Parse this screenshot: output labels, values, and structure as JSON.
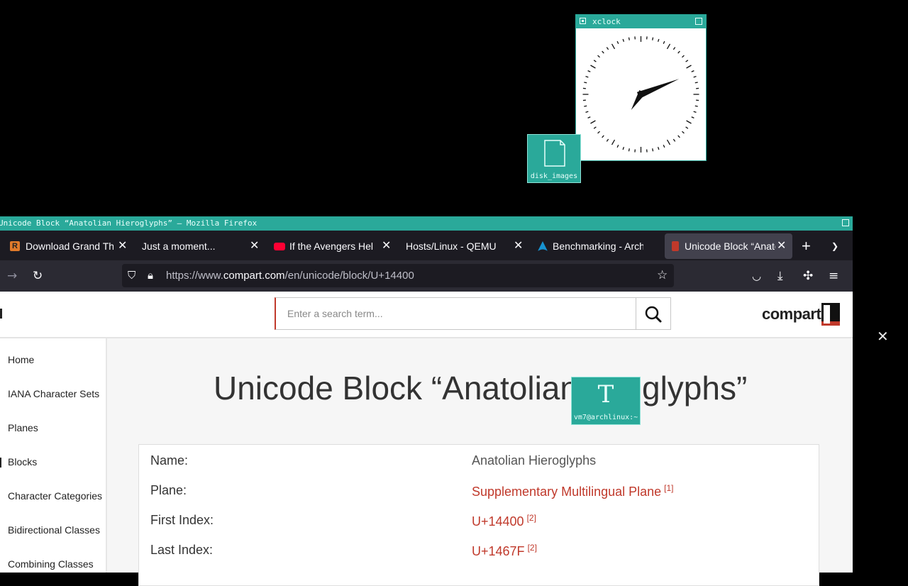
{
  "xclock": {
    "title": "xclock"
  },
  "desktop": {
    "disk_label": "disk_images",
    "terminal_label": "vm7@archlinux:~"
  },
  "firefox": {
    "window_title": "Unicode Block “Anatolian Hieroglyphs” – Mozilla Firefox",
    "tabs": [
      {
        "title": "Download Grand Theft Auto",
        "favicon": "r-icon"
      },
      {
        "title": "Just a moment...",
        "favicon": "none"
      },
      {
        "title": "If the Avengers Hel",
        "favicon": "youtube-icon"
      },
      {
        "title": "Hosts/Linux - QEMU",
        "favicon": "none"
      },
      {
        "title": "Benchmarking - Arch",
        "favicon": "arch-icon"
      },
      {
        "title": "Unicode Block “Anatolian",
        "favicon": "compart-icon"
      }
    ],
    "url_prefix": "https://www.",
    "url_domain": "compart.com",
    "url_path": "/en/unicode/block/U+14400"
  },
  "site": {
    "search_placeholder": "Enter a search term...",
    "logo_text": "compart",
    "sidebar": [
      "Home",
      "IANA Character Sets",
      "Planes",
      "Blocks",
      "Character Categories",
      "Bidirectional Classes",
      "Combining Classes"
    ],
    "heading_part1": "Unicode Block “Anatolian",
    "heading_part2": "glyphs”",
    "info": [
      {
        "key": "Name:",
        "value": "Anatolian Hieroglyphs",
        "ref": ""
      },
      {
        "key": "Plane:",
        "value": "Supplementary Multilingual Plane",
        "ref": "[1]"
      },
      {
        "key": "First Index:",
        "value": "U+14400",
        "ref": "[2]"
      },
      {
        "key": "Last Index:",
        "value": "U+1467F",
        "ref": "[2]"
      }
    ]
  },
  "colors": {
    "teal": "#2aa99a",
    "accent": "#c0392b",
    "tabbar": "#1c1b22"
  }
}
